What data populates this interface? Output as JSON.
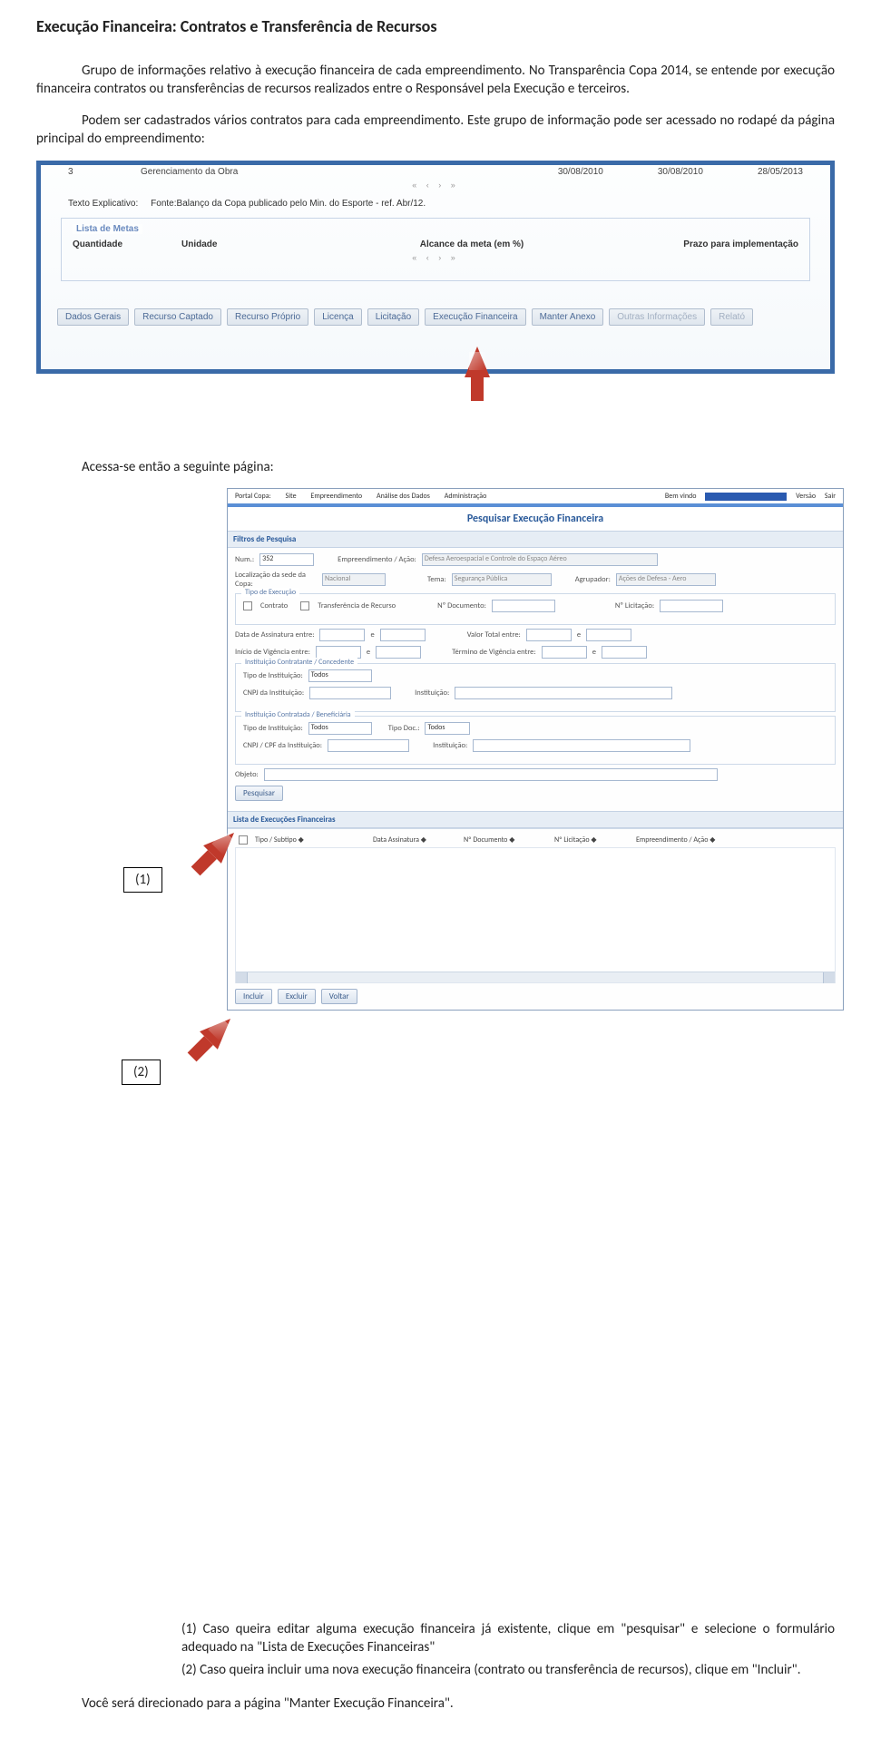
{
  "doc": {
    "title": "Execução Financeira: Contratos e Transferência de Recursos",
    "p1": "Grupo de informações relativo à execução financeira de cada empreendimento. No Transparência Copa 2014, se entende por execução financeira contratos ou transferências de recursos realizados entre o Responsável pela Execução e terceiros.",
    "p2": "Podem ser cadastrados vários contratos para cada empreendimento. Este grupo de informação pode ser acessado no rodapé da página principal do empreendimento:",
    "p3": "Acessa-se então a seguinte página:",
    "callout1": "(1)",
    "callout2": "(2)",
    "li1": "(1) Caso queira editar alguma execução financeira já existente, clique em \"pesquisar\" e selecione o formulário adequado na \"Lista de Execuções Financeiras\"",
    "li2": "(2) Caso queira incluir uma nova execução financeira (contrato ou transferência de recursos), clique em \"Incluir\".",
    "final": "Você será direcionado para a página \"Manter Execução Financeira\"."
  },
  "s1": {
    "row": {
      "num": "3",
      "nome": "Gerenciamento da Obra",
      "d1": "30/08/2010",
      "d2": "30/08/2010",
      "d3": "28/05/2013"
    },
    "pager": "«   ‹   ›   »",
    "texto_label": "Texto Explicativo:",
    "texto_val": "Fonte:Balanço da Copa publicado pelo Min. do Esporte - ref. Abr/12.",
    "metas_title": "Lista de Metas",
    "th1": "Quantidade",
    "th2": "Unidade",
    "th3": "Alcance da meta (em %)",
    "th4": "Prazo para implementação",
    "tabs": [
      "Dados Gerais",
      "Recurso Captado",
      "Recurso Próprio",
      "Licença",
      "Licitação",
      "Execução Financeira",
      "Manter Anexo",
      "Outras Informações",
      "Relató"
    ]
  },
  "s2": {
    "nav": {
      "l": [
        "Portal Copa:",
        "Site",
        "Empreendimento",
        "Análise dos Dados",
        "Administração"
      ],
      "r": [
        "Bem vindo",
        "Versão",
        "Sair"
      ]
    },
    "title": "Pesquisar Execução Financeira",
    "filtros": "Filtros de Pesquisa",
    "num_l": "Num.:",
    "num_v": "352",
    "emp_l": "Empreendimento / Ação:",
    "emp_v": "Defesa Aeroespacial e Controle do Espaço Aéreo",
    "loc_l": "Localização da sede da Copa:",
    "loc_v": "Nacional",
    "tema_l": "Tema:",
    "tema_v": "Segurança Pública",
    "agr_l": "Agrupador:",
    "agr_v": "Ações de Defesa - Aero",
    "tipoexec_title": "Tipo de Execução",
    "chk_contrato": "Contrato",
    "chk_transf": "Transferência de Recurso",
    "ndoc_l": "Nº Documento:",
    "nlic_l": "Nº Licitação:",
    "dass_l": "Data de Assinatura entre:",
    "e": "e",
    "vtot_l": "Valor Total entre:",
    "ivig_l": "Início de Vigência entre:",
    "tvig_l": "Término de Vigência entre:",
    "inst1_title": "Instituição Contratante / Concedente",
    "inst2_title": "Instituição Contratada / Beneficiária",
    "tipoinst_l": "Tipo de Instituição:",
    "todos": "Todos",
    "cnpj_l": "CNPJ da Instituição:",
    "cnpjcpf_l": "CNPJ / CPF da Instituição:",
    "inst_l": "Instituição:",
    "tipodoc_l": "Tipo Doc.:",
    "obj_l": "Objeto:",
    "pesq": "Pesquisar",
    "lista_title": "Lista de Execuções Financeiras",
    "cols": [
      "",
      "Tipo / Subtipo ◆",
      "Data Assinatura ◆",
      "Nº Documento ◆",
      "Nº Licitação ◆",
      "Empreendimento / Ação ◆"
    ],
    "incluir": "Incluir",
    "excluir": "Excluir",
    "voltar": "Voltar"
  }
}
